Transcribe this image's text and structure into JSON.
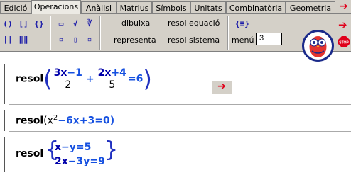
{
  "tabs": [
    "Edició",
    "Operacions",
    "Anàlisi",
    "Matrius",
    "Símbols",
    "Unitats",
    "Combinatòria",
    "Geometria"
  ],
  "active_tab": "Operacions",
  "toolbar": {
    "dibuixa_label": "dibuixa",
    "representa_label": "representa",
    "resol_equacio_label": "resol equació",
    "resol_sistema_label": "resol sistema",
    "menu_label": "menú",
    "number_value": "3"
  },
  "cells": {
    "c1": {
      "cmd": "resol",
      "n1": "3x",
      "n1b": "−1",
      "d1": "2",
      "plus": "+",
      "n2": "2x",
      "n2b": "+4",
      "d2": "5",
      "eq": "=",
      "rhs": "6"
    },
    "c2": {
      "cmd": "resol",
      "expr_a": "(x",
      "sup": "2",
      "expr_b": "−6x",
      "expr_c": "+3",
      "expr_d": "=",
      "expr_e": "0)"
    },
    "c3": {
      "cmd": "resol",
      "r1a": "x",
      "r1b": "−y",
      "r1c": "=",
      "r1d": "5",
      "r2a": "2x",
      "r2b": "−3y",
      "r2c": "=",
      "r2d": "9"
    }
  },
  "go_button_icon": "red-arrow-icon",
  "colors": {
    "accent": "#1550e0",
    "variable": "#0000aa",
    "arrow": "#e0001a"
  }
}
